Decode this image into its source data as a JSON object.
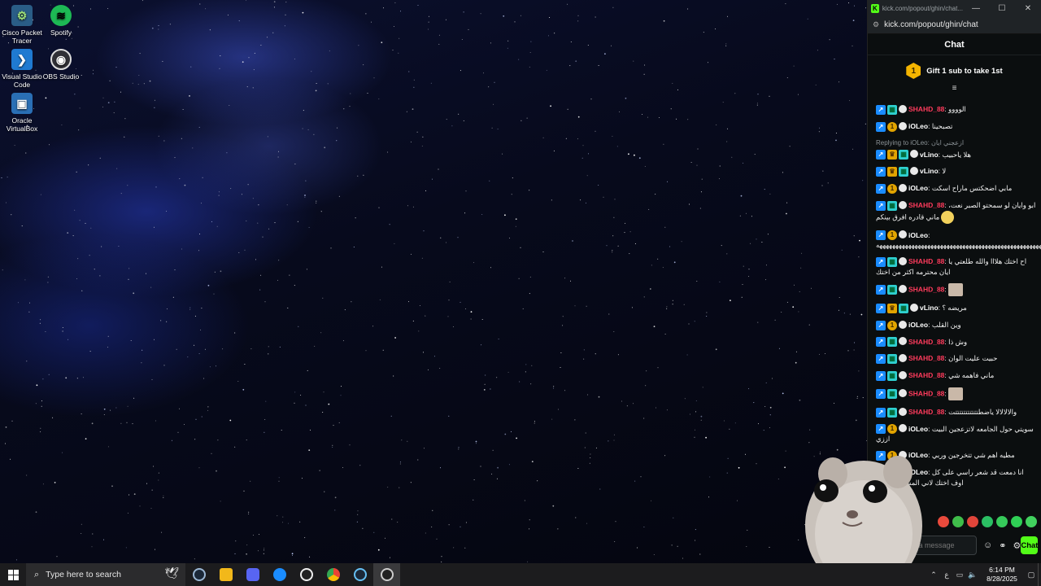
{
  "desktop": {
    "icons": [
      {
        "label_line1": "Cisco Packet",
        "label_line2": "Tracer",
        "icon": "cisco-packet-tracer-icon"
      },
      {
        "label_line1": "Spotify",
        "label_line2": "",
        "icon": "spotify-icon"
      },
      {
        "label_line1": "Visual Studio",
        "label_line2": "Code",
        "icon": "vscode-icon"
      },
      {
        "label_line1": "OBS Studio",
        "label_line2": "",
        "icon": "obs-studio-icon"
      },
      {
        "label_line1": "Oracle",
        "label_line2": "VirtualBox",
        "icon": "virtualbox-icon"
      }
    ]
  },
  "chat_window": {
    "title": "kick.com/popout/ghin/chat...",
    "url": "kick.com/popout/ghin/chat",
    "header": "Chat",
    "gift": {
      "text": "Gift 1 sub to take 1st",
      "medal_number": "1"
    },
    "messages": [
      {
        "user": "SHAHD_88",
        "color": "#ff3b5c",
        "badges": [
          "arrow",
          "bars"
        ],
        "text": "الوووو"
      },
      {
        "user": "iOLeo",
        "color": "#ffffff",
        "badges": [
          "arrow",
          "one"
        ],
        "text": "تصبحينا"
      },
      {
        "reply": "Replying to iOLeo: ازعجني ايان",
        "user": "vLino",
        "color": "#ffffff",
        "badges": [
          "arrow",
          "crown",
          "bars"
        ],
        "text": "هلا ياحبيب"
      },
      {
        "user": "vLino",
        "color": "#ffffff",
        "badges": [
          "arrow",
          "crown",
          "bars"
        ],
        "text": "لا"
      },
      {
        "user": "iOLeo",
        "color": "#ffffff",
        "badges": [
          "arrow",
          "one"
        ],
        "text": "مابي اضحكتس ماراح اسكت"
      },
      {
        "user": "SHAHD_88",
        "color": "#ff3b5c",
        "badges": [
          "arrow",
          "bars"
        ],
        "text": "ابو وايان لو سمحتو الصبر نعت، ماني قادره افرق بينكم",
        "emoji": true
      },
      {
        "user": "iOLeo",
        "color": "#ffffff",
        "badges": [
          "arrow",
          "one"
        ],
        "text": "ههههههههههههههههههههههههههههههههههههههههههههههههههههههههههههههههههههههههه"
      },
      {
        "user": "SHAHD_88",
        "color": "#ff3b5c",
        "badges": [
          "arrow",
          "bars"
        ],
        "text": "اح اختك هلااا والله طلعتي يا ايان محترمه اكثر من اختك"
      },
      {
        "user": "SHAHD_88",
        "color": "#ff3b5c",
        "badges": [
          "arrow",
          "bars"
        ],
        "text": "",
        "thumb": true
      },
      {
        "user": "vLino",
        "color": "#ffffff",
        "badges": [
          "arrow",
          "crown",
          "bars"
        ],
        "text": "مريضه ؟"
      },
      {
        "user": "iOLeo",
        "color": "#ffffff",
        "badges": [
          "arrow",
          "one"
        ],
        "text": "وين القلب"
      },
      {
        "user": "SHAHD_88",
        "color": "#ff3b5c",
        "badges": [
          "arrow",
          "bars"
        ],
        "text": "وش ذا"
      },
      {
        "user": "SHAHD_88",
        "color": "#ff3b5c",
        "badges": [
          "arrow",
          "bars"
        ],
        "text": "حبيت عليت الوان"
      },
      {
        "user": "SHAHD_88",
        "color": "#ff3b5c",
        "badges": [
          "arrow",
          "bars"
        ],
        "text": "ماني فاهمه شي"
      },
      {
        "user": "SHAHD_88",
        "color": "#ff3b5c",
        "badges": [
          "arrow",
          "bars"
        ],
        "text": "",
        "thumb": true
      },
      {
        "user": "SHAHD_88",
        "color": "#ff3b5c",
        "badges": [
          "arrow",
          "bars"
        ],
        "text": "والالالالا ياضطتتتتتتتتتتتت"
      },
      {
        "user": "iOLeo",
        "color": "#ffffff",
        "badges": [
          "arrow",
          "one"
        ],
        "text": "سويتي حول الجامعه لاتزعجين البيت اززي"
      },
      {
        "user": "iOLeo",
        "color": "#ffffff",
        "badges": [
          "arrow",
          "one"
        ],
        "text": "مطيه اهم شي تتخرجين وربي"
      },
      {
        "user": "iOLeo",
        "color": "#ffffff",
        "badges": [
          "arrow",
          "one"
        ],
        "text": "انا دمعت قد شعر راسي على كل اوف اختك لاني المسطت صبعه"
      }
    ],
    "input_placeholder": "Send a message",
    "send_label": "Chat"
  },
  "taskbar": {
    "search_placeholder": "Type here to search",
    "time": "6:14 PM",
    "date": "8/28/2025",
    "language": "ع",
    "apps": [
      "steam-icon",
      "files-icon",
      "discord-icon",
      "sync-icon",
      "obs-icon",
      "chrome-icon",
      "steam-icon",
      "obs-icon"
    ]
  },
  "colors": {
    "kick_green": "#53fc18",
    "username_red": "#ff3b5c"
  }
}
